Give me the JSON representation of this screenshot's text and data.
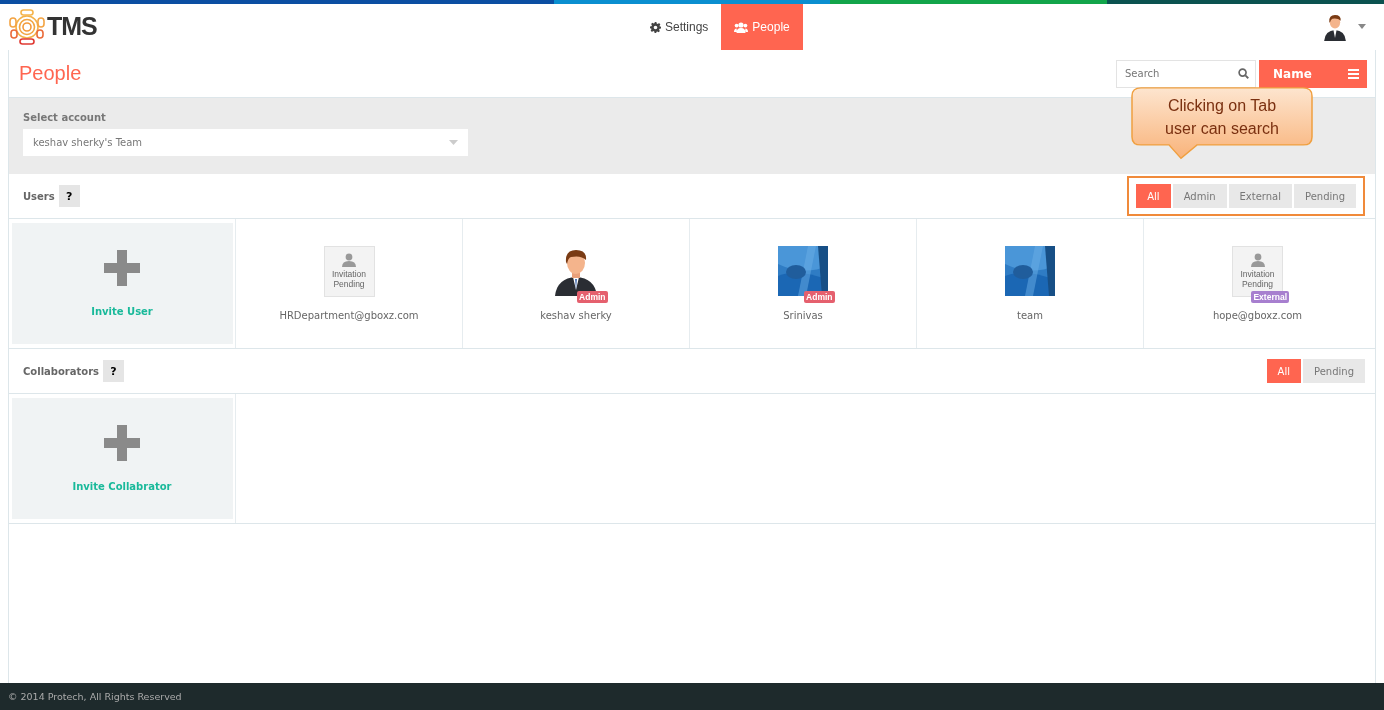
{
  "brand": {
    "name": "TMS"
  },
  "nav": [
    {
      "label": "Settings",
      "kind": "gear",
      "selected": false
    },
    {
      "label": "People",
      "kind": "people",
      "selected": true
    }
  ],
  "page": {
    "title": "People",
    "search": {
      "placeholder": "Search"
    },
    "sort_button": "Name"
  },
  "account": {
    "label": "Select account",
    "value": "keshav sherky's Team"
  },
  "callout": {
    "text": "Clicking on Tab user can search"
  },
  "users": {
    "title": "Users",
    "help": "?",
    "invite": "Invite User",
    "filters": [
      {
        "label": "All",
        "selected": true
      },
      {
        "label": "Admin",
        "selected": false
      },
      {
        "label": "External",
        "selected": false
      },
      {
        "label": "Pending",
        "selected": false
      }
    ],
    "people": [
      {
        "name": "HRDepartment@gboxz.com",
        "kind": "placeholder",
        "avatar_text": "Invitation Pending"
      },
      {
        "name": "keshav sherky",
        "kind": "person",
        "badge": {
          "text": "Admin",
          "color": "#e5606e"
        }
      },
      {
        "name": "Srinivas",
        "kind": "picture",
        "badge": {
          "text": "Admin",
          "color": "#e5606e"
        }
      },
      {
        "name": "team",
        "kind": "picture"
      },
      {
        "name": "hope@gboxz.com",
        "kind": "placeholder",
        "avatar_text": "Invitation Pending",
        "badge": {
          "text": "External",
          "color": "#a77fcf"
        }
      }
    ]
  },
  "collaborators": {
    "title": "Collaborators",
    "help": "?",
    "invite": "Invite Collabrator",
    "filters": [
      {
        "label": "All",
        "selected": true
      },
      {
        "label": "Pending",
        "selected": false
      }
    ]
  },
  "footer": {
    "text": "© 2014 Protech, All Rights Reserved"
  }
}
